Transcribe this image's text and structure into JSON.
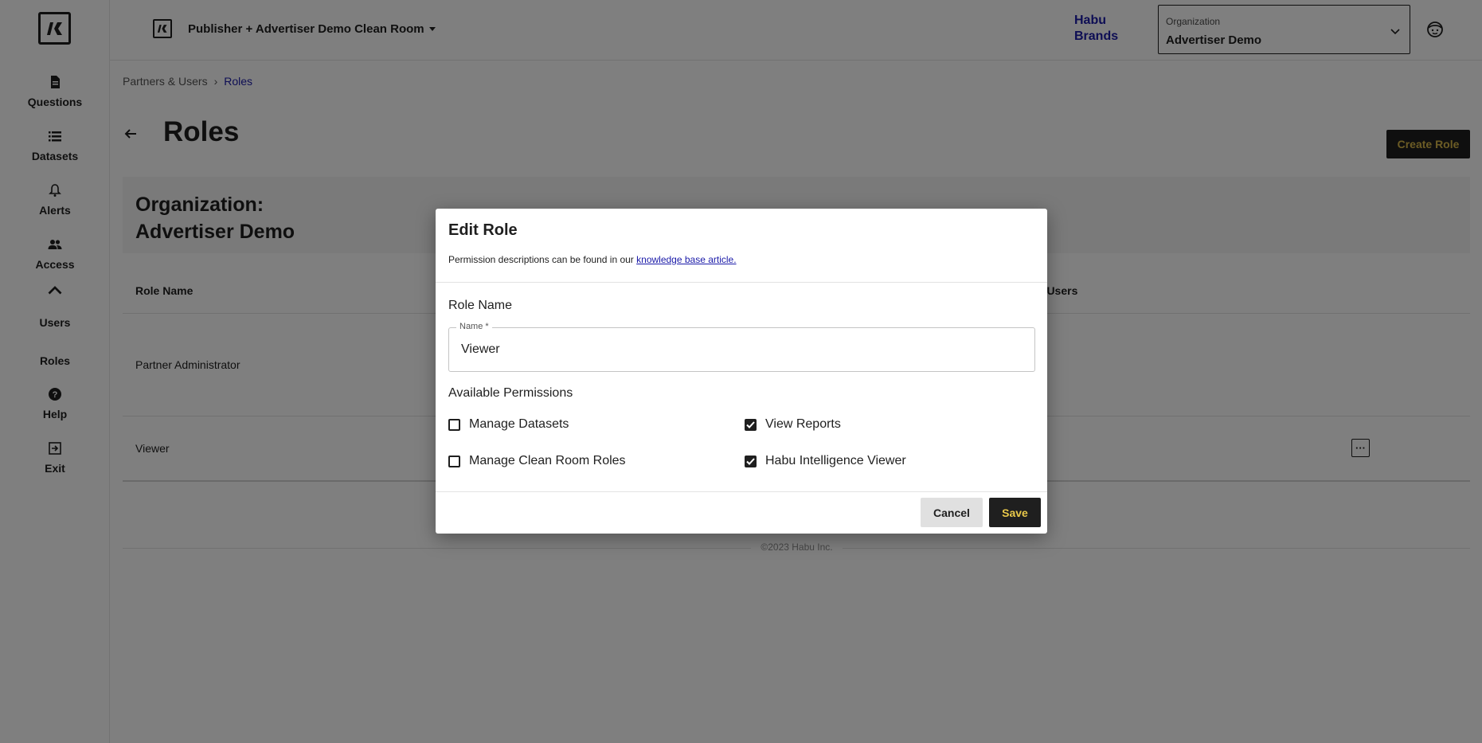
{
  "sidebar": {
    "logo_icon": "habu-logo-icon",
    "items": [
      {
        "label": "Questions",
        "icon": "document-icon"
      },
      {
        "label": "Datasets",
        "icon": "list-icon"
      },
      {
        "label": "Alerts",
        "icon": "bell-icon"
      },
      {
        "label": "Access",
        "icon": "people-icon"
      },
      {
        "label": "Users"
      },
      {
        "label": "Roles"
      },
      {
        "label": "Help",
        "icon": "help-icon"
      },
      {
        "label": "Exit",
        "icon": "exit-icon"
      }
    ]
  },
  "header": {
    "clean_room_title": "Publisher + Advertiser Demo Clean Room",
    "brand": "Habu Brands",
    "org_select": {
      "label": "Organization",
      "value": "Advertiser Demo"
    }
  },
  "breadcrumb": {
    "parent": "Partners & Users",
    "separator": "›",
    "current": "Roles"
  },
  "page": {
    "title": "Roles",
    "create_button": "Create Role"
  },
  "org_panel": {
    "line1": "Organization:",
    "line2": "Advertiser Demo"
  },
  "table": {
    "columns": [
      "Role Name",
      "n Users"
    ],
    "rows": [
      {
        "role_name": "Partner Administrator"
      },
      {
        "role_name": "Viewer",
        "menu": "···"
      }
    ]
  },
  "footer": {
    "copyright": "©2023 Habu Inc."
  },
  "modal": {
    "title": "Edit Role",
    "description": "Permission descriptions can be found in our ",
    "link_text": "knowledge base article.",
    "role_name_section": "Role Name",
    "name_field_label": "Name *",
    "name_field_value": "Viewer",
    "permissions_section": "Available Permissions",
    "permissions": [
      {
        "label": "Manage Datasets",
        "checked": false
      },
      {
        "label": "View Reports",
        "checked": true
      },
      {
        "label": "Manage Clean Room Roles",
        "checked": false
      },
      {
        "label": "Habu Intelligence Viewer",
        "checked": true
      }
    ],
    "cancel_label": "Cancel",
    "save_label": "Save"
  },
  "colors": {
    "brand_blue": "#1a1aa8",
    "dark": "#1f1f1f",
    "accent_gold": "#e8c84a",
    "overlay": "rgba(0,0,0,0.5)"
  }
}
